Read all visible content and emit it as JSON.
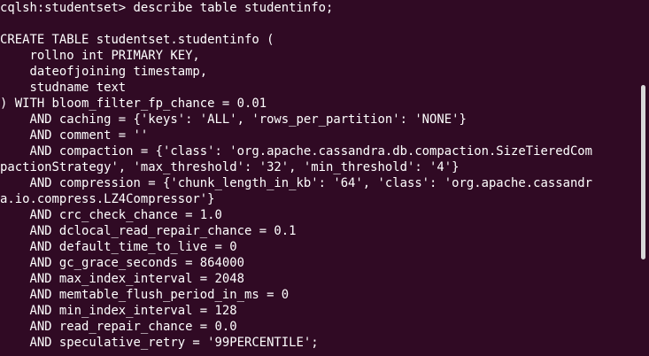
{
  "terminal": {
    "lines": [
      "cqlsh:studentset> describe table studentinfo;",
      "",
      "CREATE TABLE studentset.studentinfo (",
      "    rollno int PRIMARY KEY,",
      "    dateofjoining timestamp,",
      "    studname text",
      ") WITH bloom_filter_fp_chance = 0.01",
      "    AND caching = {'keys': 'ALL', 'rows_per_partition': 'NONE'}",
      "    AND comment = ''",
      "    AND compaction = {'class': 'org.apache.cassandra.db.compaction.SizeTieredCom",
      "pactionStrategy', 'max_threshold': '32', 'min_threshold': '4'}",
      "    AND compression = {'chunk_length_in_kb': '64', 'class': 'org.apache.cassandr",
      "a.io.compress.LZ4Compressor'}",
      "    AND crc_check_chance = 1.0",
      "    AND dclocal_read_repair_chance = 0.1",
      "    AND default_time_to_live = 0",
      "    AND gc_grace_seconds = 864000",
      "    AND max_index_interval = 2048",
      "    AND memtable_flush_period_in_ms = 0",
      "    AND min_index_interval = 128",
      "    AND read_repair_chance = 0.0",
      "    AND speculative_retry = '99PERCENTILE';"
    ]
  },
  "colors": {
    "background": "#300a24",
    "foreground": "#ffffff",
    "scrollbar": "#d8d8d8"
  }
}
